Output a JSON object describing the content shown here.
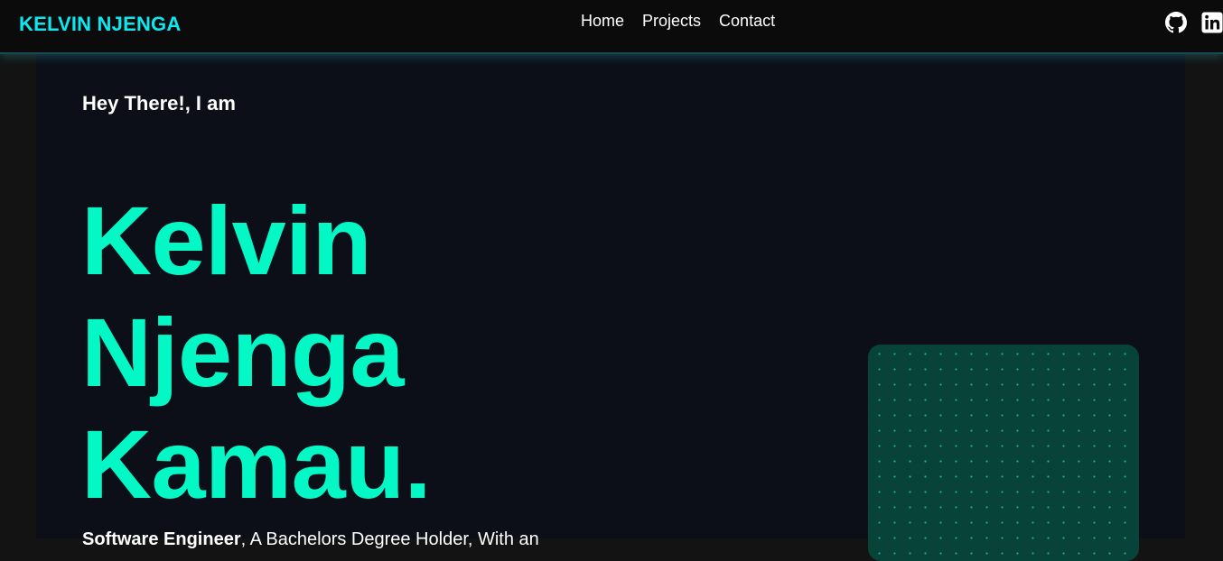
{
  "navbar": {
    "brand": "KELVIN NJENGA",
    "links": [
      {
        "label": "Home"
      },
      {
        "label": "Projects"
      },
      {
        "label": "Contact"
      }
    ],
    "socials": [
      {
        "icon": "github-icon"
      },
      {
        "icon": "linkedin-icon"
      }
    ]
  },
  "hero": {
    "greeting": "Hey There!, I am",
    "name_lines": [
      "Kelvin",
      "Njenga",
      "Kamau."
    ],
    "tagline_bold": "Software Engineer",
    "tagline_rest": ", A Bachelors Degree Holder, With an"
  },
  "colors": {
    "brand": "#0ce8f0",
    "accent": "#04f8c6",
    "navbar_bg": "#0b0b0b",
    "page_bg": "#0c0f18",
    "card_bg": "#08433a"
  }
}
